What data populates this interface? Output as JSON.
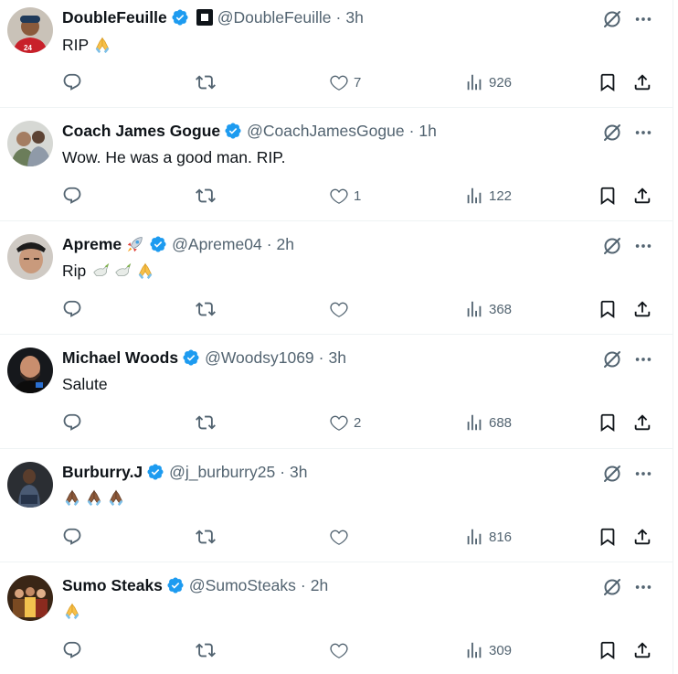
{
  "tweets": [
    {
      "name": "DoubleFeuille",
      "affiliate_badge": "square-affiliate-icon",
      "handle": "@DoubleFeuille",
      "dot": "·",
      "time": "3h",
      "text": "RIP",
      "text_emoji": [
        "folded-hands"
      ],
      "likes": "7",
      "views": "926"
    },
    {
      "name": "Coach James Gogue",
      "handle": "@CoachJamesGogue",
      "dot": "·",
      "time": "1h",
      "text": "Wow. He was a good man. RIP.",
      "likes": "1",
      "views": "122"
    },
    {
      "name": "Apreme",
      "name_emoji": "rocket",
      "handle": "@Apreme04",
      "dot": "·",
      "time": "2h",
      "text": "Rip",
      "text_emoji": [
        "dove",
        "dove",
        "folded-hands"
      ],
      "likes": "",
      "views": "368"
    },
    {
      "name": "Michael Woods",
      "handle": "@Woodsy1069",
      "dot": "·",
      "time": "3h",
      "text": "Salute",
      "likes": "2",
      "views": "688"
    },
    {
      "name": "Burburry.J",
      "handle": "@j_burburry25",
      "dot": "·",
      "time": "3h",
      "text": "",
      "text_emoji": [
        "folded-hands-dark",
        "folded-hands-dark",
        "folded-hands-dark"
      ],
      "likes": "",
      "views": "816"
    },
    {
      "name": "Sumo Steaks",
      "handle": "@SumoSteaks",
      "dot": "·",
      "time": "2h",
      "text": "",
      "text_emoji": [
        "folded-hands"
      ],
      "likes": "",
      "views": "309"
    }
  ],
  "colors": {
    "verified": "#1d9bf0",
    "muted": "#536471",
    "text": "#0f1419",
    "divider": "#eff3f4"
  },
  "icons": {
    "reply": "reply-icon",
    "retweet": "retweet-icon",
    "like": "heart-icon",
    "views": "views-chart-icon",
    "bookmark": "bookmark-icon",
    "share": "share-icon",
    "grok": "grok-icon",
    "more": "more-dots-icon"
  }
}
